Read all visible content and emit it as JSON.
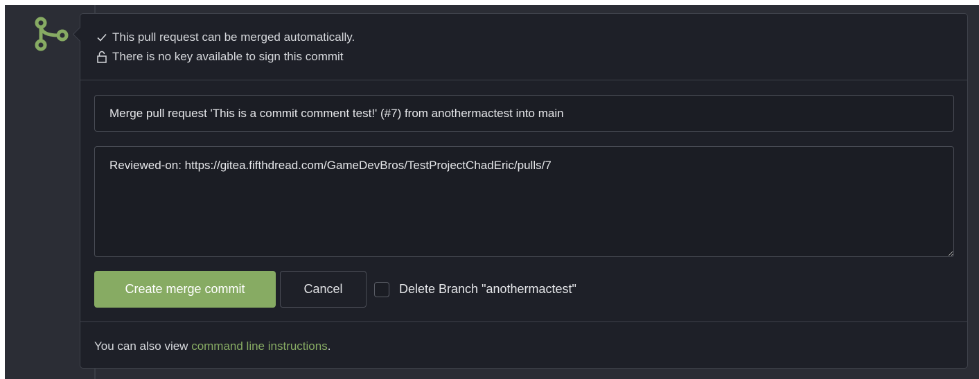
{
  "status": {
    "merge_check": "This pull request can be merged automatically.",
    "sign_status": "There is no key available to sign this commit"
  },
  "form": {
    "title_value": "Merge pull request 'This is a commit comment test!' (#7) from anothermactest into main",
    "message_value": "Reviewed-on: https://gitea.fifthdread.com/GameDevBros/TestProjectChadEric/pulls/7",
    "merge_button_label": "Create merge commit",
    "cancel_button_label": "Cancel",
    "delete_branch_label": "Delete Branch \"anothermactest\"",
    "delete_branch_checked": false
  },
  "footer": {
    "prefix": "You can also view ",
    "link_text": "command line instructions",
    "suffix": "."
  },
  "icons": {
    "timeline": "git-merge-icon",
    "merge_check": "check-icon",
    "sign_status": "unlock-icon"
  },
  "colors": {
    "accent_green": "#87ab63",
    "panel_bg": "#1e2028",
    "page_bg": "#2b2d35"
  }
}
